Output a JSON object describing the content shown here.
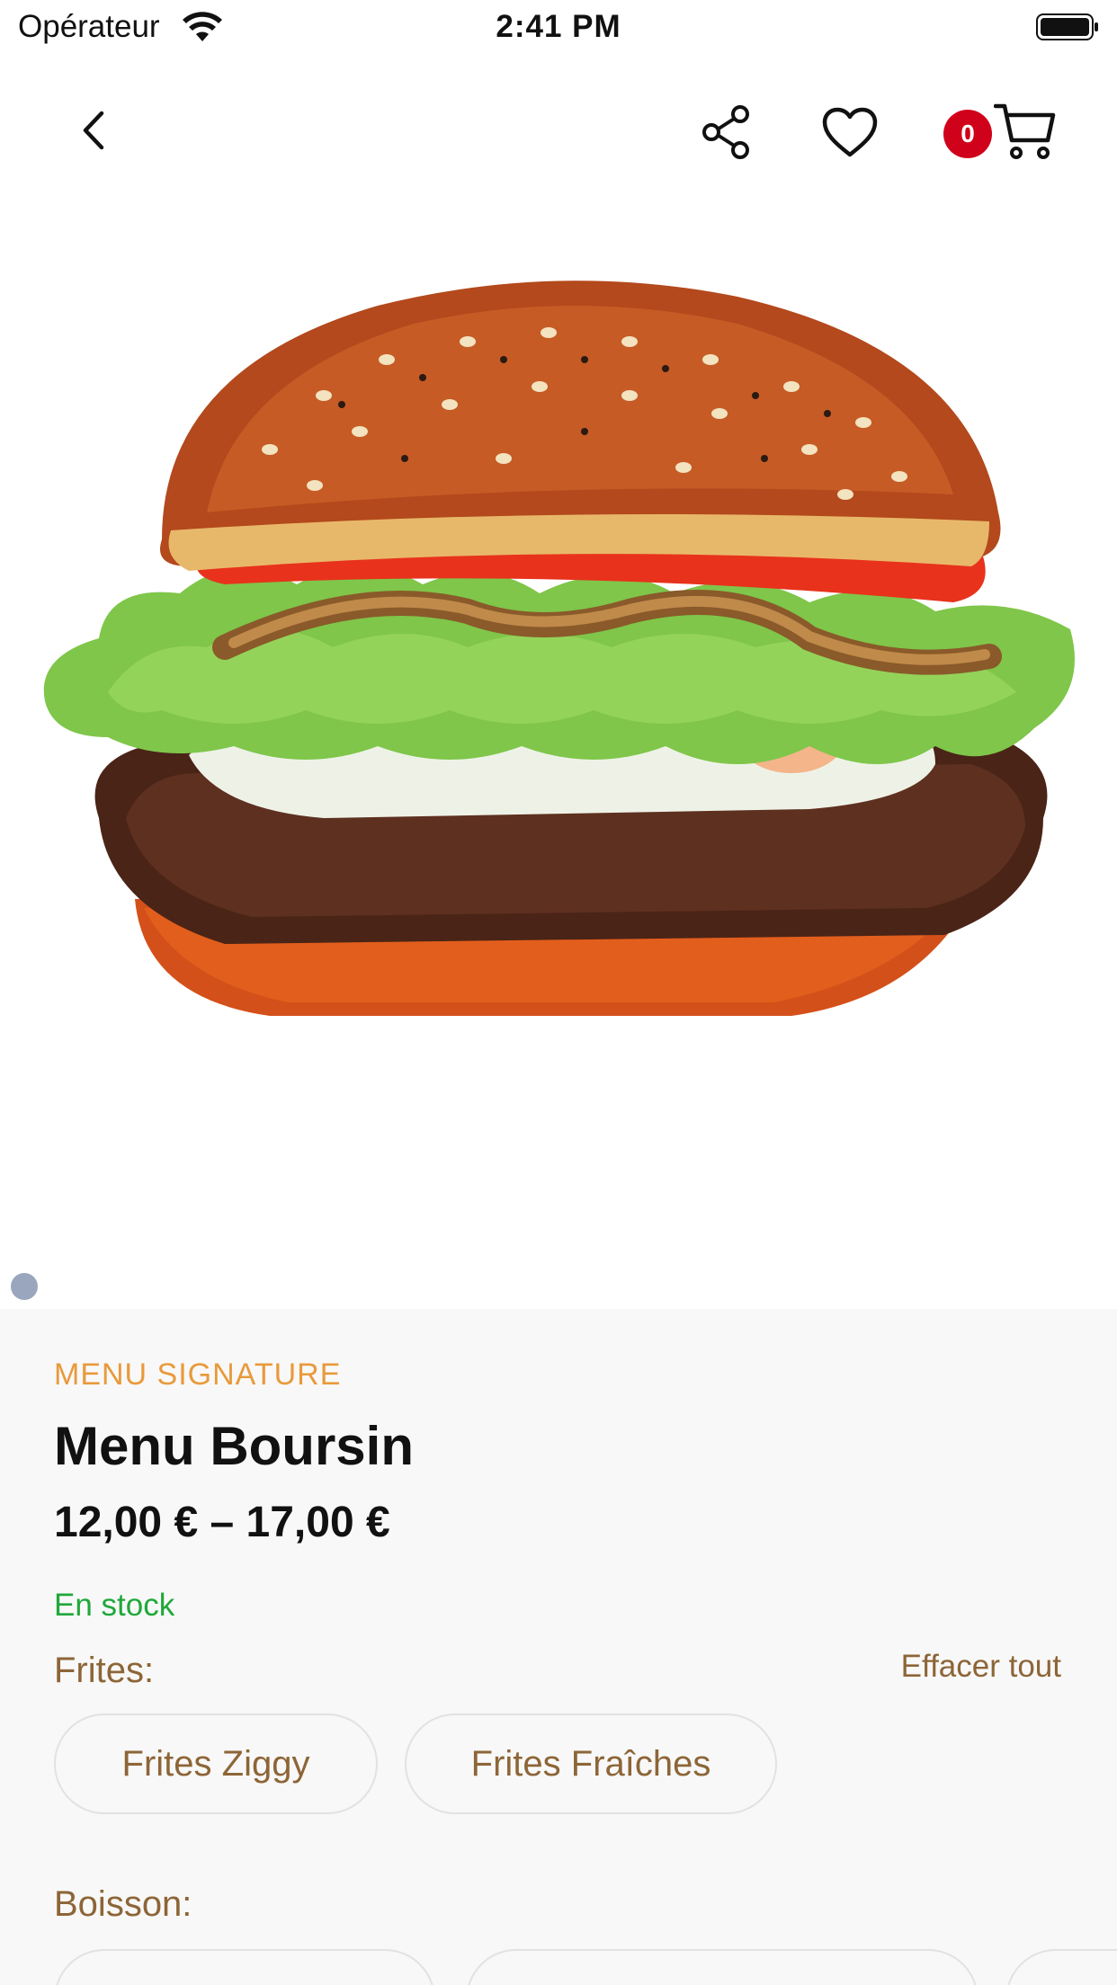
{
  "status_bar": {
    "carrier": "Opérateur",
    "time": "2:41 PM"
  },
  "nav": {
    "icons": [
      "chevron-left-icon",
      "share-icon",
      "heart-icon",
      "cart-icon"
    ],
    "cart_count": "0"
  },
  "product": {
    "image": "burger-photo",
    "category": "MENU SIGNATURE",
    "title": "Menu Boursin",
    "price": "12,00 € – 17,00 €",
    "stock": "En stock"
  },
  "options": {
    "clear_all": "Effacer tout",
    "frites": {
      "label": "Frites:",
      "choices": [
        "Frites Ziggy",
        "Frites Fraîches"
      ]
    },
    "boisson": {
      "label": "Boisson:"
    }
  },
  "colors": {
    "accent": "#e89a3c",
    "option_text": "#8d6537",
    "stock": "#1fa83a",
    "badge": "#d0021b",
    "panel_bg": "#f8f8f8"
  }
}
